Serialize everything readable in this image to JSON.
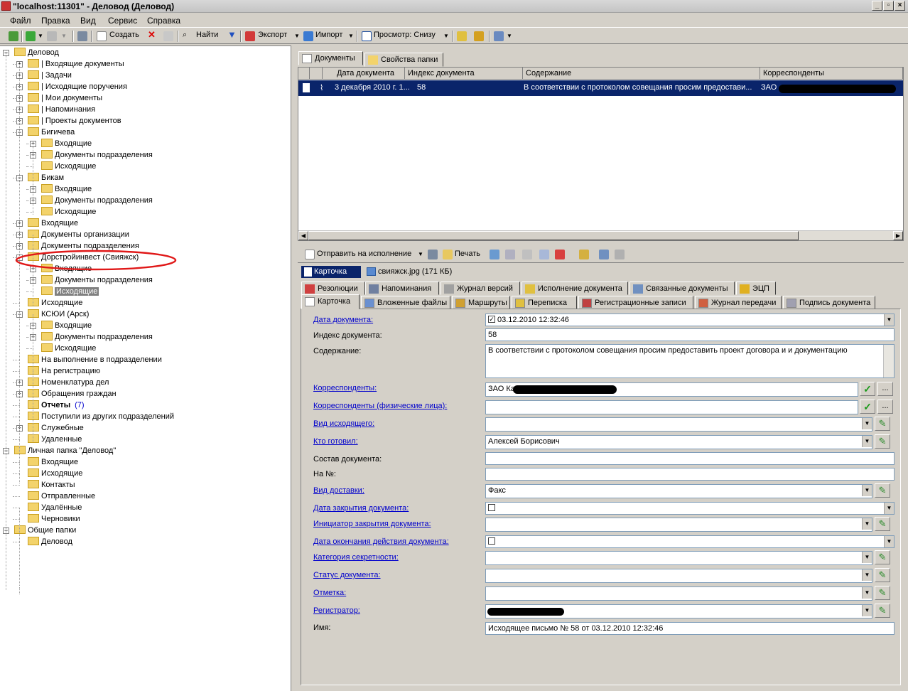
{
  "window": {
    "title": "\"localhost:11301\" - Деловод (Деловод)"
  },
  "menu": [
    "Файл",
    "Правка",
    "Вид",
    "Сервис",
    "Справка"
  ],
  "toolbar": {
    "create": "Создать",
    "find": "Найти",
    "export": "Экспорт",
    "import": "Импорт",
    "view": "Просмотр: Снизу"
  },
  "tree": [
    {
      "label": "Деловод"
    },
    {
      "label": "| Входящие документы"
    },
    {
      "label": "| Задачи"
    },
    {
      "label": "| Исходящие поручения"
    },
    {
      "label": "| Мои документы"
    },
    {
      "label": "| Напоминания"
    },
    {
      "label": "| Проекты документов"
    },
    {
      "label": "Бигичева"
    },
    {
      "label": "Входящие"
    },
    {
      "label": "Документы подразделения"
    },
    {
      "label": "Исходящие"
    },
    {
      "label": "Бикам"
    },
    {
      "label": "Входящие"
    },
    {
      "label": "Документы подразделения"
    },
    {
      "label": "Исходящие"
    },
    {
      "label": "Входящие"
    },
    {
      "label": "Документы организации"
    },
    {
      "label": "Документы подразделения"
    },
    {
      "label": "Дорстройинвест (Свияжск)"
    },
    {
      "label": "Входящие"
    },
    {
      "label": "Документы подразделения"
    },
    {
      "label": "Исходящие"
    },
    {
      "label": "Исходящие"
    },
    {
      "label": "КСЮИ (Арск)"
    },
    {
      "label": "Входящие"
    },
    {
      "label": "Документы подразделения"
    },
    {
      "label": "Исходящие"
    },
    {
      "label": "На выполнение в подразделении"
    },
    {
      "label": "На регистрацию"
    },
    {
      "label": "Номенклатура дел"
    },
    {
      "label": "Обращения граждан"
    },
    {
      "label": "Отчеты",
      "count": "(7)"
    },
    {
      "label": "Поступили из других подразделений"
    },
    {
      "label": "Служебные"
    },
    {
      "label": "Удаленные"
    },
    {
      "label": "Личная папка \"Деловод\""
    },
    {
      "label": "Входящие"
    },
    {
      "label": "Исходящие"
    },
    {
      "label": "Контакты"
    },
    {
      "label": "Отправленные"
    },
    {
      "label": "Удалённые"
    },
    {
      "label": "Черновики"
    },
    {
      "label": "Общие папки"
    },
    {
      "label": "Деловод"
    }
  ],
  "topTabs": [
    "Документы",
    "Свойства папки"
  ],
  "grid": {
    "columns": [
      "Дата документа",
      "Индекс документа",
      "Содержание",
      "Корреспонденты"
    ],
    "row": {
      "date": "3 декабря 2010 г. 1...",
      "index": "58",
      "content": "В соответствии с протоколом совещания просим предостави...",
      "corr": "ЗАО"
    }
  },
  "docToolbar": {
    "send": "Отправить на исполнение",
    "print": "Печать"
  },
  "cardTabs": {
    "card": "Карточка",
    "file": "свияжск.jpg (171 КБ)"
  },
  "tabsRow1": [
    "Резолюции",
    "Напоминания",
    "Журнал версий",
    "Исполнение документа",
    "Связанные документы",
    "ЭЦП"
  ],
  "tabsRow2": [
    "Карточка",
    "Вложенные файлы",
    "Маршруты",
    "Переписка",
    "Регистрационные записи",
    "Журнал передачи",
    "Подпись документа"
  ],
  "form": {
    "docDate": {
      "label": "Дата документа:",
      "value": "03.12.2010 12:32:46"
    },
    "docIndex": {
      "label": "Индекс документа:",
      "value": "58"
    },
    "content": {
      "label": "Содержание:",
      "value": "В соответствии с протоколом совещания просим предоставить проект договора и и документацию"
    },
    "corr": {
      "label": "Корреспонденты:",
      "value": "ЗАО Ка"
    },
    "corrPersons": {
      "label": "Корреспонденты (физические лица):",
      "value": ""
    },
    "outType": {
      "label": "Вид исходящего:",
      "value": ""
    },
    "preparedBy": {
      "label": "Кто готовил:",
      "value": "Алексей Борисович"
    },
    "composition": {
      "label": "Состав документа:",
      "value": ""
    },
    "toNumber": {
      "label": "На №:",
      "value": ""
    },
    "delivery": {
      "label": "Вид доставки:",
      "value": "Факс"
    },
    "closeDate": {
      "label": "Дата закрытия документа:",
      "value": ""
    },
    "closeInitiator": {
      "label": "Инициатор закрытия документа:",
      "value": ""
    },
    "expiryDate": {
      "label": "Дата окончания действия документа:",
      "value": ""
    },
    "secrecy": {
      "label": "Категория секретности:",
      "value": ""
    },
    "status": {
      "label": "Статус документа:",
      "value": ""
    },
    "mark": {
      "label": "Отметка:",
      "value": ""
    },
    "registrar": {
      "label": "Регистратор:",
      "value": ""
    },
    "name": {
      "label": "Имя:",
      "value": "Исходящее письмо № 58 от 03.12.2010 12:32:46"
    }
  }
}
